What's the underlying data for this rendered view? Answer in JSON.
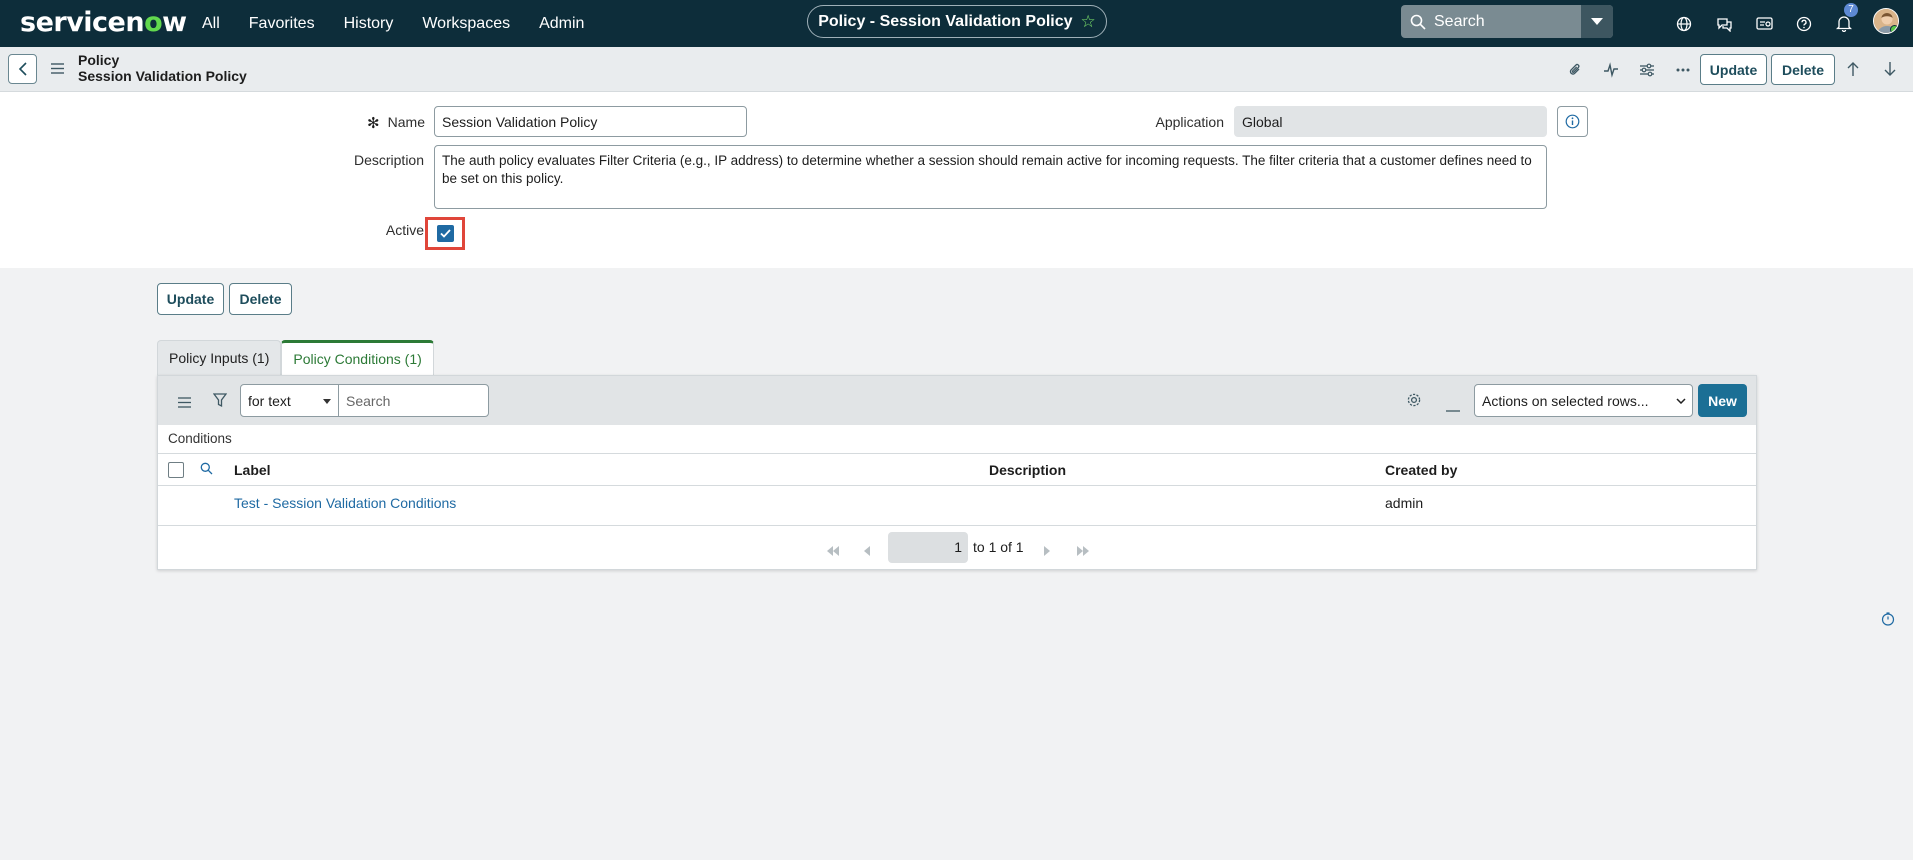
{
  "app": {
    "logo_text": "servicenow"
  },
  "topnav": {
    "items": [
      "All",
      "Favorites",
      "History",
      "Workspaces",
      "Admin"
    ],
    "record_title": "Policy - Session Validation Policy",
    "search_placeholder": "Search",
    "notification_count": "7"
  },
  "form_header": {
    "table_label": "Policy",
    "record_name": "Session Validation Policy",
    "update_label": "Update",
    "delete_label": "Delete"
  },
  "form": {
    "name_label": "Name",
    "name_value": "Session Validation Policy",
    "application_label": "Application",
    "application_value": "Global",
    "description_label": "Description",
    "description_value": "The auth policy evaluates Filter Criteria (e.g., IP address) to determine whether a session should remain active for incoming requests.  The filter criteria that a customer defines need to be set on this policy.",
    "active_label": "Active",
    "active_checked": true
  },
  "form_buttons": {
    "update_label": "Update",
    "delete_label": "Delete"
  },
  "tabs": [
    {
      "label": "Policy Inputs (1)",
      "active": false
    },
    {
      "label": "Policy Conditions (1)",
      "active": true
    }
  ],
  "related_list": {
    "search_field": "for text",
    "search_placeholder": "Search",
    "actions_select": "Actions on selected rows...",
    "new_label": "New",
    "breadcrumb": "Conditions",
    "columns": [
      "Label",
      "Description",
      "Created by"
    ],
    "rows": [
      {
        "label": "Test - Session Validation Conditions",
        "description": "",
        "created_by": "admin"
      }
    ],
    "pager": {
      "current": "1",
      "text": "to 1 of 1"
    }
  },
  "colors": {
    "nav_bg": "#0d2d3a",
    "accent_green": "#2c7a36",
    "link_blue": "#1f6aa3",
    "new_button": "#1b6f95"
  }
}
